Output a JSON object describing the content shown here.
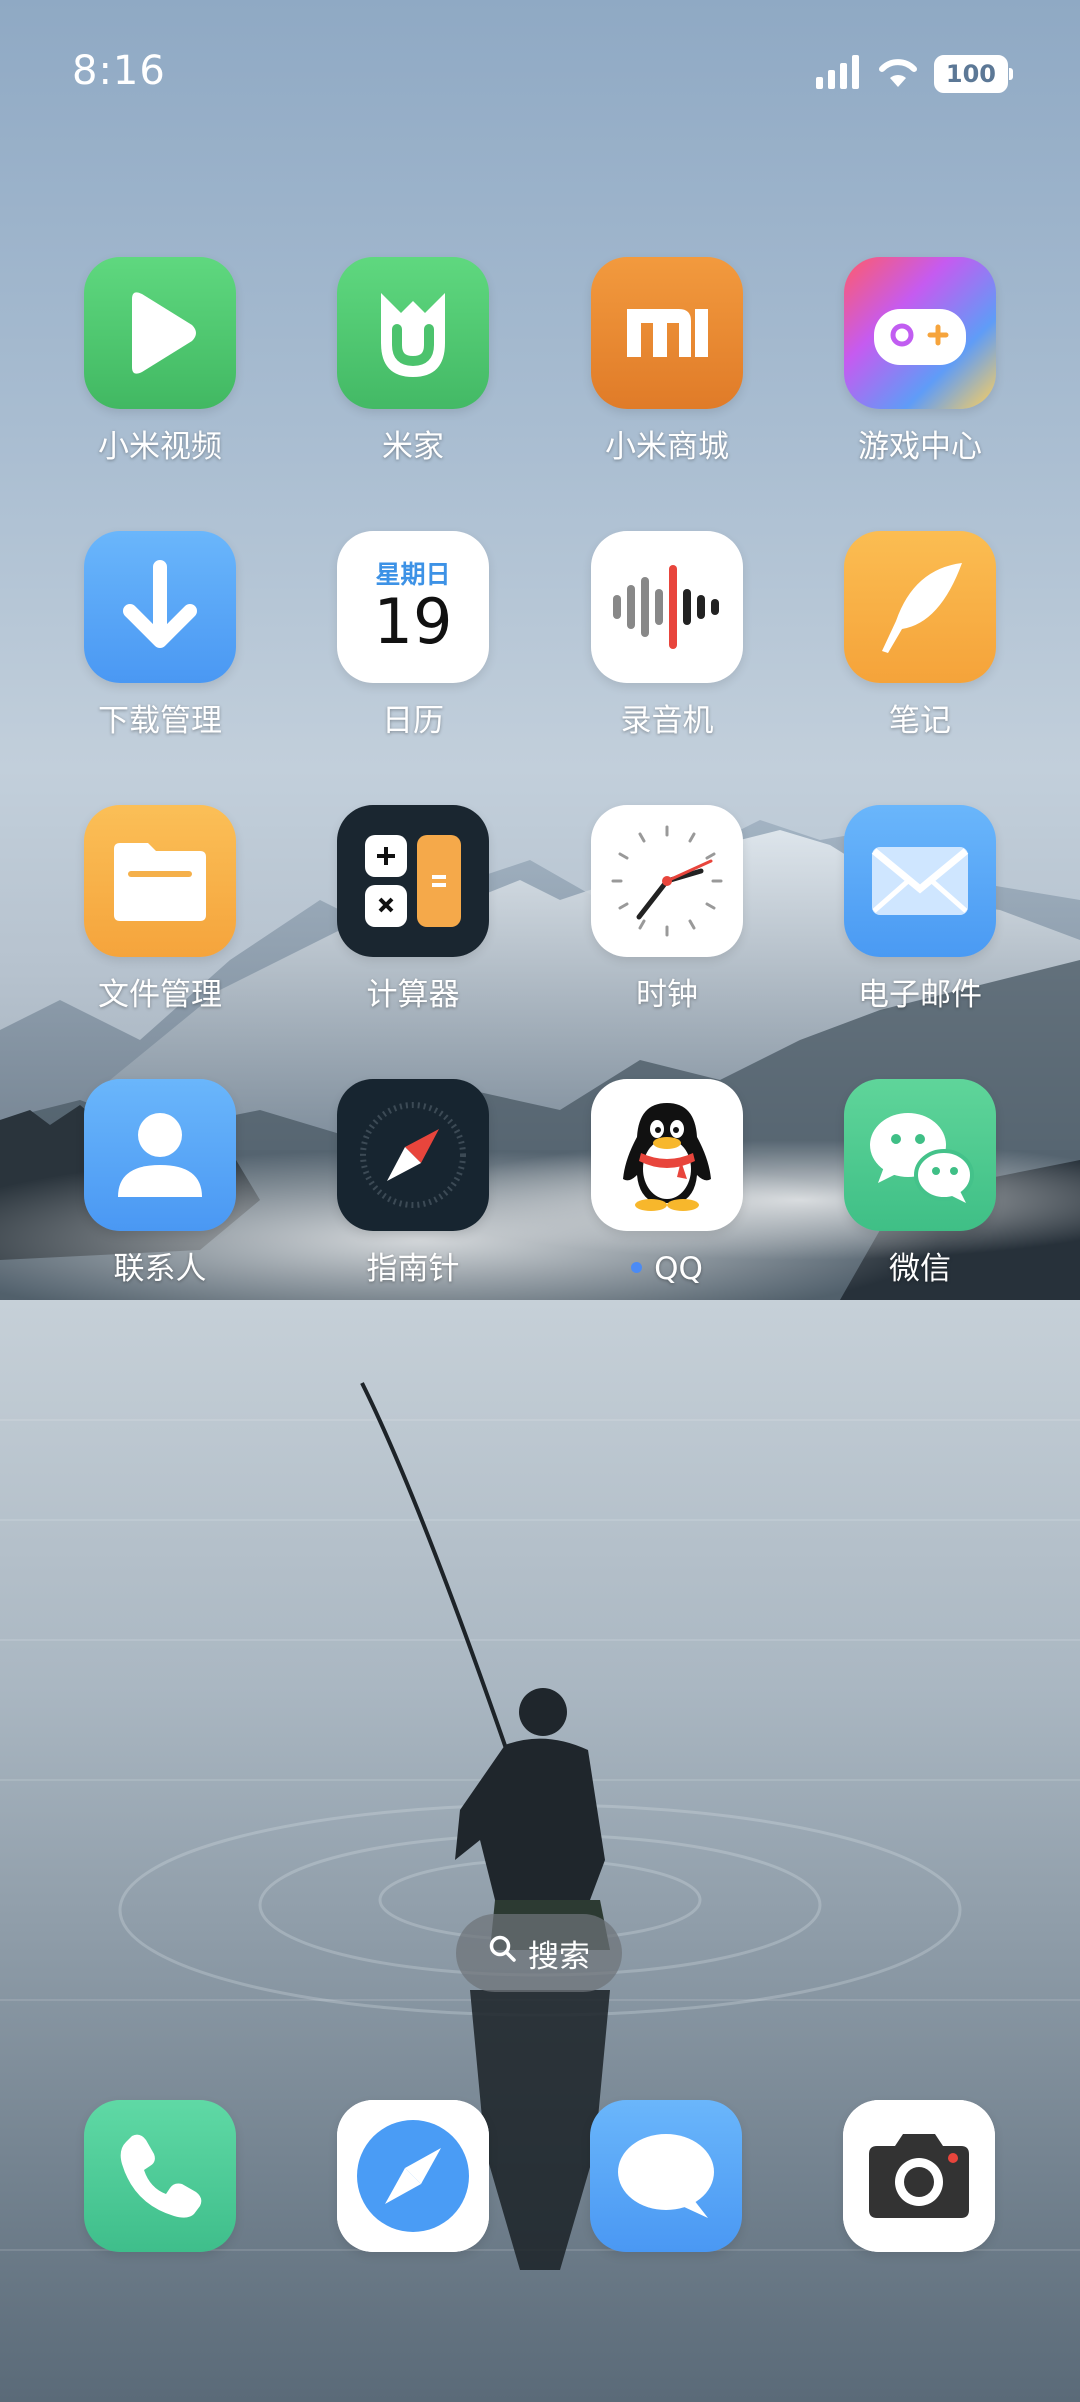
{
  "status_bar": {
    "time": "8:16",
    "battery": "100",
    "signal_icon": "cellular-signal-icon",
    "wifi_icon": "wifi-icon"
  },
  "apps": {
    "row1": [
      {
        "label": "小米视频",
        "icon": "play-icon"
      },
      {
        "label": "米家",
        "icon": "mijia-icon"
      },
      {
        "label": "小米商城",
        "icon": "mi-logo-icon"
      },
      {
        "label": "游戏中心",
        "icon": "gamepad-icon"
      }
    ],
    "row2": [
      {
        "label": "下载管理",
        "icon": "download-arrow-icon"
      },
      {
        "label": "日历",
        "icon": "calendar-icon",
        "weekday": "星期日",
        "day": "19"
      },
      {
        "label": "录音机",
        "icon": "waveform-icon"
      },
      {
        "label": "笔记",
        "icon": "quill-icon"
      }
    ],
    "row3": [
      {
        "label": "文件管理",
        "icon": "folder-icon"
      },
      {
        "label": "计算器",
        "icon": "calculator-icon"
      },
      {
        "label": "时钟",
        "icon": "clock-icon"
      },
      {
        "label": "电子邮件",
        "icon": "envelope-icon"
      }
    ],
    "row4": [
      {
        "label": "联系人",
        "icon": "person-icon"
      },
      {
        "label": "指南针",
        "icon": "compass-icon"
      },
      {
        "label": "QQ",
        "icon": "penguin-icon",
        "new_badge": true
      },
      {
        "label": "微信",
        "icon": "wechat-bubbles-icon"
      }
    ]
  },
  "search": {
    "label": "搜索",
    "icon": "search-icon"
  },
  "dock": [
    {
      "name": "phone",
      "icon": "phone-icon"
    },
    {
      "name": "browser",
      "icon": "browser-compass-icon"
    },
    {
      "name": "messages",
      "icon": "message-bubble-icon"
    },
    {
      "name": "camera",
      "icon": "camera-icon"
    }
  ]
}
